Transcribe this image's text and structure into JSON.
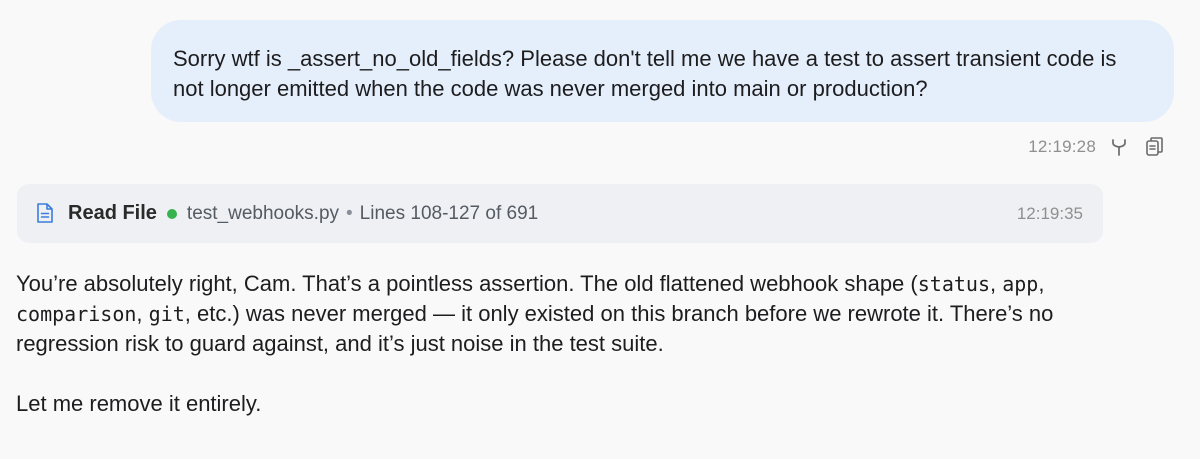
{
  "user_message": {
    "text": "Sorry wtf is _assert_no_old_fields? Please don't tell me we have a test to assert transient code is not longer emitted when the code was never merged into main or production?",
    "timestamp": "12:19:28",
    "actions": [
      {
        "icon": "branch-icon"
      },
      {
        "icon": "copy-icon"
      }
    ]
  },
  "tool_call": {
    "icon": "file-icon",
    "label": "Read File",
    "status_color": "#37b24d",
    "file": "test_webhooks.py",
    "separator": "•",
    "lines": "Lines 108-127 of 691",
    "timestamp": "12:19:35"
  },
  "assistant_message": {
    "para1": {
      "t1": "You’re absolutely right, Cam. That’s a pointless assertion. The old flattened webhook shape (",
      "c1": "status",
      "t2": ", ",
      "c2": "app",
      "t3": ", ",
      "c3": "comparison",
      "t4": ", ",
      "c4": "git",
      "t5": ", etc.) was never merged — it only existed on this branch before we rewrote it. There’s no regression risk to guard against, and it’s just noise in the test suite."
    },
    "para2": "Let me remove it entirely."
  }
}
